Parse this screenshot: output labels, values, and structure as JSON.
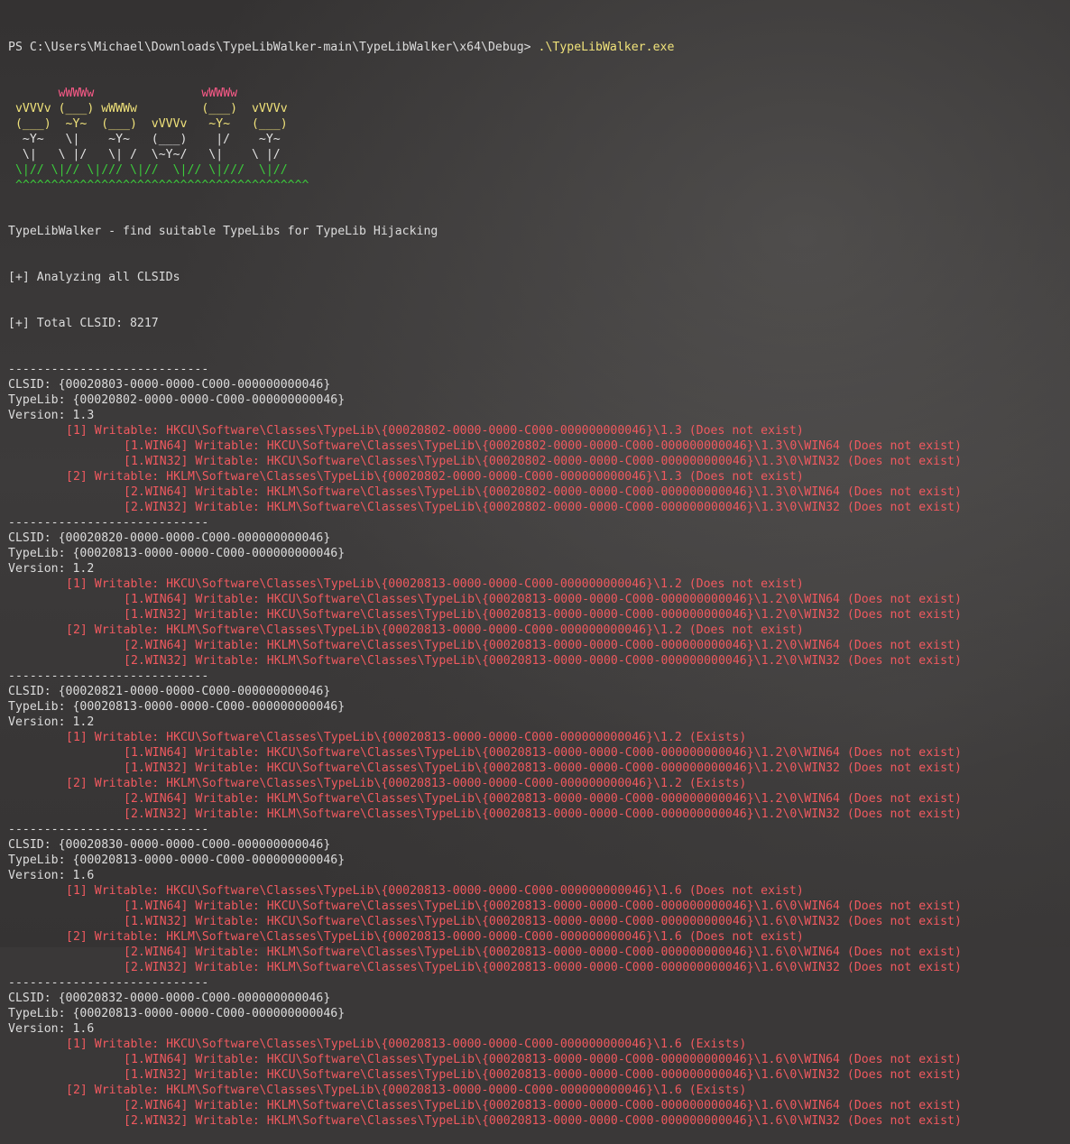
{
  "prompt": {
    "text": "PS C:\\Users\\Michael\\Downloads\\TypeLibWalker-main\\TypeLibWalker\\x64\\Debug> ",
    "command": ".\\TypeLibWalker.exe"
  },
  "banner": [
    [
      {
        "t": "       ",
        "c": "wht"
      },
      {
        "t": "wWWWw",
        "c": "pink"
      },
      {
        "t": "               ",
        "c": "wht"
      },
      {
        "t": "wWWWw",
        "c": "pink"
      }
    ],
    [
      {
        "t": " vVVVv (___) wWWWw         (___)  vVVVv",
        "c": "yel"
      }
    ],
    [
      {
        "t": " (___)  ~Y~  (___)  vVVVv   ~Y~   (___)",
        "c": "yel"
      }
    ],
    [
      {
        "t": "  ~Y~   \\|    ~Y~   (___)    |/    ~Y~",
        "c": "wht"
      }
    ],
    [
      {
        "t": "  \\|   \\ |/   \\| /  \\~Y~/   \\|    \\ |/",
        "c": "wht"
      }
    ],
    [
      {
        "t": " \\|// \\|// \\|/// \\|//  \\|// \\|///  \\|//",
        "c": "grn"
      }
    ],
    [
      {
        "t": " ^^^^^^^^^^^^^^^^^^^^^^^^^^^^^^^^^^^^^^^^^",
        "c": "grn"
      }
    ]
  ],
  "header": [
    "TypeLibWalker - find suitable TypeLibs for TypeLib Hijacking",
    "[+] Analyzing all CLSIDs",
    "[+] Total CLSID: 8217"
  ],
  "separator": "----------------------------",
  "entries": [
    {
      "clsid": "CLSID: {00020803-0000-0000-C000-000000000046}",
      "typelib": "TypeLib: {00020802-0000-0000-C000-000000000046}",
      "version": "Version: 1.3",
      "lines": [
        {
          "indent": 1,
          "text": "[1] Writable: HKCU\\Software\\Classes\\TypeLib\\{00020802-0000-0000-C000-000000000046}\\1.3 (Does not exist)"
        },
        {
          "indent": 2,
          "text": "[1.WIN64] Writable: HKCU\\Software\\Classes\\TypeLib\\{00020802-0000-0000-C000-000000000046}\\1.3\\0\\WIN64 (Does not exist)"
        },
        {
          "indent": 2,
          "text": "[1.WIN32] Writable: HKCU\\Software\\Classes\\TypeLib\\{00020802-0000-0000-C000-000000000046}\\1.3\\0\\WIN32 (Does not exist)"
        },
        {
          "indent": 1,
          "text": "[2] Writable: HKLM\\Software\\Classes\\TypeLib\\{00020802-0000-0000-C000-000000000046}\\1.3 (Does not exist)"
        },
        {
          "indent": 2,
          "text": "[2.WIN64] Writable: HKLM\\Software\\Classes\\TypeLib\\{00020802-0000-0000-C000-000000000046}\\1.3\\0\\WIN64 (Does not exist)"
        },
        {
          "indent": 2,
          "text": "[2.WIN32] Writable: HKLM\\Software\\Classes\\TypeLib\\{00020802-0000-0000-C000-000000000046}\\1.3\\0\\WIN32 (Does not exist)"
        }
      ]
    },
    {
      "clsid": "CLSID: {00020820-0000-0000-C000-000000000046}",
      "typelib": "TypeLib: {00020813-0000-0000-C000-000000000046}",
      "version": "Version: 1.2",
      "lines": [
        {
          "indent": 1,
          "text": "[1] Writable: HKCU\\Software\\Classes\\TypeLib\\{00020813-0000-0000-C000-000000000046}\\1.2 (Does not exist)"
        },
        {
          "indent": 2,
          "text": "[1.WIN64] Writable: HKCU\\Software\\Classes\\TypeLib\\{00020813-0000-0000-C000-000000000046}\\1.2\\0\\WIN64 (Does not exist)"
        },
        {
          "indent": 2,
          "text": "[1.WIN32] Writable: HKCU\\Software\\Classes\\TypeLib\\{00020813-0000-0000-C000-000000000046}\\1.2\\0\\WIN32 (Does not exist)"
        },
        {
          "indent": 1,
          "text": "[2] Writable: HKLM\\Software\\Classes\\TypeLib\\{00020813-0000-0000-C000-000000000046}\\1.2 (Does not exist)"
        },
        {
          "indent": 2,
          "text": "[2.WIN64] Writable: HKLM\\Software\\Classes\\TypeLib\\{00020813-0000-0000-C000-000000000046}\\1.2\\0\\WIN64 (Does not exist)"
        },
        {
          "indent": 2,
          "text": "[2.WIN32] Writable: HKLM\\Software\\Classes\\TypeLib\\{00020813-0000-0000-C000-000000000046}\\1.2\\0\\WIN32 (Does not exist)"
        }
      ]
    },
    {
      "clsid": "CLSID: {00020821-0000-0000-C000-000000000046}",
      "typelib": "TypeLib: {00020813-0000-0000-C000-000000000046}",
      "version": "Version: 1.2",
      "lines": [
        {
          "indent": 1,
          "text": "[1] Writable: HKCU\\Software\\Classes\\TypeLib\\{00020813-0000-0000-C000-000000000046}\\1.2 (Exists)"
        },
        {
          "indent": 2,
          "text": "[1.WIN64] Writable: HKCU\\Software\\Classes\\TypeLib\\{00020813-0000-0000-C000-000000000046}\\1.2\\0\\WIN64 (Does not exist)"
        },
        {
          "indent": 2,
          "text": "[1.WIN32] Writable: HKCU\\Software\\Classes\\TypeLib\\{00020813-0000-0000-C000-000000000046}\\1.2\\0\\WIN32 (Does not exist)"
        },
        {
          "indent": 1,
          "text": "[2] Writable: HKLM\\Software\\Classes\\TypeLib\\{00020813-0000-0000-C000-000000000046}\\1.2 (Exists)"
        },
        {
          "indent": 2,
          "text": "[2.WIN64] Writable: HKLM\\Software\\Classes\\TypeLib\\{00020813-0000-0000-C000-000000000046}\\1.2\\0\\WIN64 (Does not exist)"
        },
        {
          "indent": 2,
          "text": "[2.WIN32] Writable: HKLM\\Software\\Classes\\TypeLib\\{00020813-0000-0000-C000-000000000046}\\1.2\\0\\WIN32 (Does not exist)"
        }
      ]
    },
    {
      "clsid": "CLSID: {00020830-0000-0000-C000-000000000046}",
      "typelib": "TypeLib: {00020813-0000-0000-C000-000000000046}",
      "version": "Version: 1.6",
      "lines": [
        {
          "indent": 1,
          "text": "[1] Writable: HKCU\\Software\\Classes\\TypeLib\\{00020813-0000-0000-C000-000000000046}\\1.6 (Does not exist)"
        },
        {
          "indent": 2,
          "text": "[1.WIN64] Writable: HKCU\\Software\\Classes\\TypeLib\\{00020813-0000-0000-C000-000000000046}\\1.6\\0\\WIN64 (Does not exist)"
        },
        {
          "indent": 2,
          "text": "[1.WIN32] Writable: HKCU\\Software\\Classes\\TypeLib\\{00020813-0000-0000-C000-000000000046}\\1.6\\0\\WIN32 (Does not exist)"
        },
        {
          "indent": 1,
          "text": "[2] Writable: HKLM\\Software\\Classes\\TypeLib\\{00020813-0000-0000-C000-000000000046}\\1.6 (Does not exist)"
        },
        {
          "indent": 2,
          "text": "[2.WIN64] Writable: HKLM\\Software\\Classes\\TypeLib\\{00020813-0000-0000-C000-000000000046}\\1.6\\0\\WIN64 (Does not exist)"
        },
        {
          "indent": 2,
          "text": "[2.WIN32] Writable: HKLM\\Software\\Classes\\TypeLib\\{00020813-0000-0000-C000-000000000046}\\1.6\\0\\WIN32 (Does not exist)"
        }
      ]
    },
    {
      "clsid": "CLSID: {00020832-0000-0000-C000-000000000046}",
      "typelib": "TypeLib: {00020813-0000-0000-C000-000000000046}",
      "version": "Version: 1.6",
      "lines": [
        {
          "indent": 1,
          "text": "[1] Writable: HKCU\\Software\\Classes\\TypeLib\\{00020813-0000-0000-C000-000000000046}\\1.6 (Exists)"
        },
        {
          "indent": 2,
          "text": "[1.WIN64] Writable: HKCU\\Software\\Classes\\TypeLib\\{00020813-0000-0000-C000-000000000046}\\1.6\\0\\WIN64 (Does not exist)"
        },
        {
          "indent": 2,
          "text": "[1.WIN32] Writable: HKCU\\Software\\Classes\\TypeLib\\{00020813-0000-0000-C000-000000000046}\\1.6\\0\\WIN32 (Does not exist)"
        },
        {
          "indent": 1,
          "text": "[2] Writable: HKLM\\Software\\Classes\\TypeLib\\{00020813-0000-0000-C000-000000000046}\\1.6 (Exists)"
        },
        {
          "indent": 2,
          "text": "[2.WIN64] Writable: HKLM\\Software\\Classes\\TypeLib\\{00020813-0000-0000-C000-000000000046}\\1.6\\0\\WIN64 (Does not exist)"
        },
        {
          "indent": 2,
          "text": "[2.WIN32] Writable: HKLM\\Software\\Classes\\TypeLib\\{00020813-0000-0000-C000-000000000046}\\1.6\\0\\WIN32 (Does not exist)"
        }
      ]
    }
  ],
  "colors": {
    "background": "#3a3838",
    "text": "#dcdcdc",
    "writable": "#f0595f",
    "banner_flower_top": "#ff5b8a",
    "banner_flower": "#f0e27a",
    "banner_grass": "#3bcc3b"
  }
}
